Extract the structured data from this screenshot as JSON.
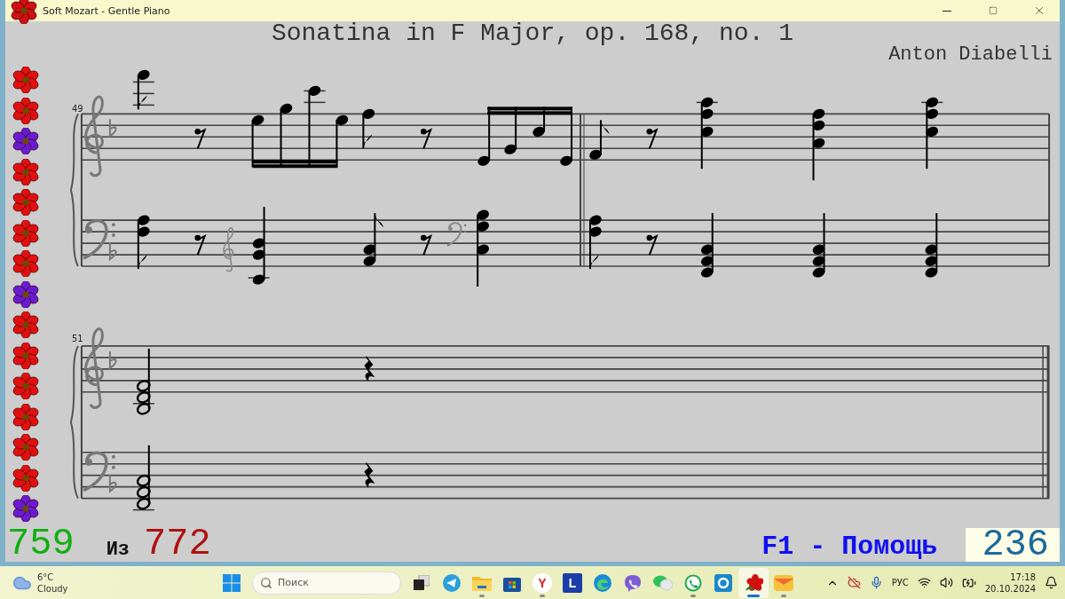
{
  "window": {
    "title": "Soft Mozart - Gentle Piano"
  },
  "score": {
    "title": "Sonatina in F Major, op. 168, no. 1",
    "composer": "Anton Diabelli",
    "systems": [
      {
        "measure_number": "49"
      },
      {
        "measure_number": "51"
      }
    ]
  },
  "flowers": [
    {
      "color": "#e01010"
    },
    {
      "color": "#e01010"
    },
    {
      "color": "#6a1ad0"
    },
    {
      "color": "#e01010"
    },
    {
      "color": "#e01010"
    },
    {
      "color": "#e01010"
    },
    {
      "color": "#e01010"
    },
    {
      "color": "#6a1ad0"
    },
    {
      "color": "#e01010"
    },
    {
      "color": "#e01010"
    },
    {
      "color": "#e01010"
    },
    {
      "color": "#e01010"
    },
    {
      "color": "#e01010"
    },
    {
      "color": "#e01010"
    },
    {
      "color": "#6a1ad0"
    }
  ],
  "status": {
    "current": "759",
    "of_label": "Из",
    "total": "772",
    "help": "F1 - Помощь",
    "counter": "236"
  },
  "taskbar": {
    "weather": {
      "temperature": "6°C",
      "condition": "Cloudy"
    },
    "search": {
      "placeholder": "Поиск"
    },
    "apps": [
      {
        "kind": "start",
        "running": false,
        "selected": false
      },
      {
        "kind": "taskview",
        "running": false,
        "selected": false
      },
      {
        "kind": "plane",
        "running": false,
        "selected": false
      },
      {
        "kind": "folder",
        "running": true,
        "selected": false
      },
      {
        "kind": "store",
        "running": false,
        "selected": false
      },
      {
        "kind": "letter",
        "label": "Y",
        "running": true,
        "selected": false
      },
      {
        "kind": "tile",
        "label": "L",
        "running": false,
        "selected": false
      },
      {
        "kind": "browser",
        "running": false,
        "selected": false
      },
      {
        "kind": "phone",
        "running": false,
        "selected": false
      },
      {
        "kind": "chat",
        "running": false,
        "selected": false
      },
      {
        "kind": "whatsapp",
        "running": true,
        "selected": false
      },
      {
        "kind": "shield",
        "running": false,
        "selected": false
      },
      {
        "kind": "score",
        "running": true,
        "selected": true
      },
      {
        "kind": "mail",
        "running": true,
        "selected": false
      }
    ],
    "language": "РУС",
    "time": "17:18",
    "date": "20.10.2024"
  }
}
